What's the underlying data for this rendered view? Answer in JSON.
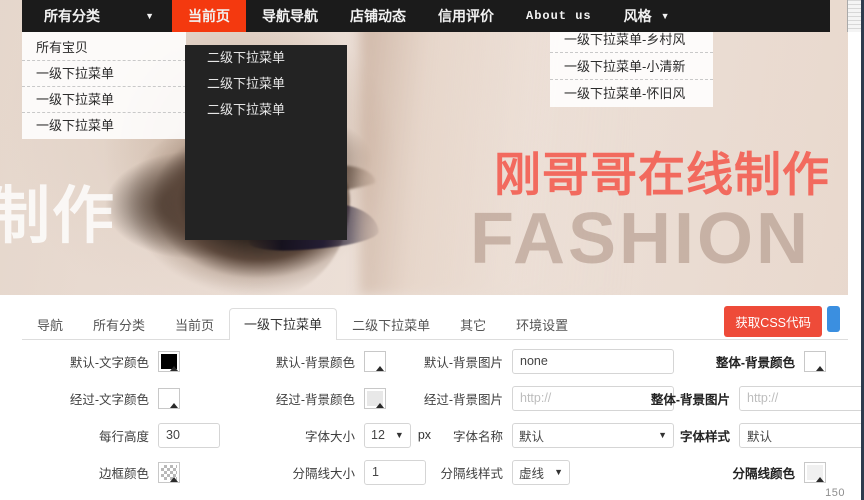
{
  "navbar": {
    "items": [
      {
        "label": "所有分类",
        "caret": "▼",
        "active": false,
        "style": "wide"
      },
      {
        "label": "当前页",
        "caret": "",
        "active": true,
        "style": "normal"
      },
      {
        "label": "导航导航",
        "caret": "",
        "active": false,
        "style": "normal"
      },
      {
        "label": "店铺动态",
        "caret": "",
        "active": false,
        "style": "normal"
      },
      {
        "label": "信用评价",
        "caret": "",
        "active": false,
        "style": "normal"
      },
      {
        "label": "About us",
        "caret": "",
        "active": false,
        "style": "latin"
      },
      {
        "label": "风格",
        "caret": "▼",
        "active": false,
        "style": "normal"
      }
    ],
    "size_readout": "150"
  },
  "dropdown_all": {
    "items": [
      "所有宝贝",
      "一级下拉菜单",
      "一级下拉菜单",
      "一级下拉菜单"
    ]
  },
  "dropdown_second": {
    "items": [
      "二级下拉菜单",
      "二级下拉菜单",
      "二级下拉菜单"
    ]
  },
  "dropdown_style": {
    "items": [
      "一级下拉菜单-乡村风",
      "一级下拉菜单-小清新",
      "一级下拉菜单-怀旧风"
    ]
  },
  "banner": {
    "watermark": "制作",
    "title": "刚哥哥在线制作",
    "subtitle": "FASHION"
  },
  "tabs": [
    {
      "label": "导航",
      "active": false
    },
    {
      "label": "所有分类",
      "active": false
    },
    {
      "label": "当前页",
      "active": false
    },
    {
      "label": "一级下拉菜单",
      "active": true
    },
    {
      "label": "二级下拉菜单",
      "active": false
    },
    {
      "label": "其它",
      "active": false
    },
    {
      "label": "环境设置",
      "active": false
    }
  ],
  "actions": {
    "css_button": "获取CSS代码"
  },
  "form": {
    "col1": [
      {
        "label": "默认-文字颜色",
        "type": "color",
        "value": "#000000"
      },
      {
        "label": "经过-文字颜色",
        "type": "color",
        "value": "#ffffff"
      },
      {
        "label": "每行高度",
        "type": "text",
        "value": "30",
        "placeholder": ""
      },
      {
        "label": "边框颜色",
        "type": "color",
        "value": "transparent"
      }
    ],
    "col2": [
      {
        "label": "默认-背景颜色",
        "type": "color",
        "value": "#ffffff"
      },
      {
        "label": "经过-背景颜色",
        "type": "color",
        "value": "#e8e8e8"
      },
      {
        "label": "字体大小",
        "type": "select",
        "value": "12",
        "unit": "px"
      },
      {
        "label": "分隔线大小",
        "type": "text",
        "value": "1",
        "placeholder": ""
      }
    ],
    "col3": [
      {
        "label": "默认-背景图片",
        "type": "text",
        "value": "none",
        "placeholder": "http://"
      },
      {
        "label": "经过-背景图片",
        "type": "text",
        "value": "",
        "placeholder": "http://"
      },
      {
        "label": "字体名称",
        "type": "select",
        "value": "默认"
      },
      {
        "label": "分隔线样式",
        "type": "select",
        "value": "虚线"
      }
    ],
    "col4": [
      {
        "label": "整体-背景颜色",
        "type": "color",
        "value": "#ffffff"
      },
      {
        "label": "整体-背景图片",
        "type": "text",
        "value": "",
        "placeholder": "http://"
      },
      {
        "label": "字体样式",
        "type": "text",
        "value": "默认",
        "placeholder": ""
      },
      {
        "label": "分隔线颜色",
        "type": "color",
        "value": "#f0f0f0"
      }
    ]
  },
  "colors": {
    "nav_bg": "#1b1b1b",
    "nav_active": "#f4390f",
    "dropdown_dark": "#232323",
    "banner_title": "#f26a5e",
    "css_button": "#ee4b39",
    "blue_button": "#3b8fe0"
  }
}
